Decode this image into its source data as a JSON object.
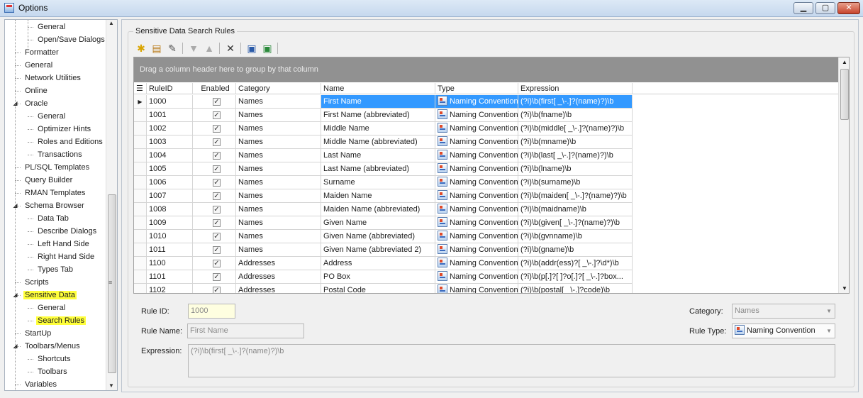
{
  "window": {
    "title": "Options",
    "min_label": "▁",
    "max_label": "▢",
    "close_label": "✕"
  },
  "tree": {
    "items": [
      {
        "label": "General",
        "level": 2,
        "highlight": false
      },
      {
        "label": "Open/Save Dialogs",
        "level": 2,
        "highlight": false
      },
      {
        "label": "Formatter",
        "level": 1,
        "highlight": false
      },
      {
        "label": "General",
        "level": 1,
        "highlight": false
      },
      {
        "label": "Network Utilities",
        "level": 1,
        "highlight": false
      },
      {
        "label": "Online",
        "level": 1,
        "highlight": false
      },
      {
        "label": "Oracle",
        "level": 1,
        "highlight": false,
        "expanded": true
      },
      {
        "label": "General",
        "level": 2,
        "highlight": false
      },
      {
        "label": "Optimizer Hints",
        "level": 2,
        "highlight": false
      },
      {
        "label": "Roles and Editions",
        "level": 2,
        "highlight": false
      },
      {
        "label": "Transactions",
        "level": 2,
        "highlight": false
      },
      {
        "label": "PL/SQL Templates",
        "level": 1,
        "highlight": false
      },
      {
        "label": "Query Builder",
        "level": 1,
        "highlight": false
      },
      {
        "label": "RMAN Templates",
        "level": 1,
        "highlight": false
      },
      {
        "label": "Schema Browser",
        "level": 1,
        "highlight": false,
        "expanded": true
      },
      {
        "label": "Data Tab",
        "level": 2,
        "highlight": false
      },
      {
        "label": "Describe Dialogs",
        "level": 2,
        "highlight": false
      },
      {
        "label": "Left Hand Side",
        "level": 2,
        "highlight": false
      },
      {
        "label": "Right Hand Side",
        "level": 2,
        "highlight": false
      },
      {
        "label": "Types Tab",
        "level": 2,
        "highlight": false
      },
      {
        "label": "Scripts",
        "level": 1,
        "highlight": false
      },
      {
        "label": "Sensitive Data",
        "level": 1,
        "highlight": true,
        "expanded": true
      },
      {
        "label": "General",
        "level": 2,
        "highlight": false
      },
      {
        "label": "Search Rules",
        "level": 2,
        "highlight": true
      },
      {
        "label": "StartUp",
        "level": 1,
        "highlight": false
      },
      {
        "label": "Toolbars/Menus",
        "level": 1,
        "highlight": false,
        "expanded": true
      },
      {
        "label": "Shortcuts",
        "level": 2,
        "highlight": false
      },
      {
        "label": "Toolbars",
        "level": 2,
        "highlight": false
      },
      {
        "label": "Variables",
        "level": 1,
        "highlight": false
      }
    ]
  },
  "panel": {
    "group_title": "Sensitive Data Search Rules",
    "group_by_hint": "Drag a column header here to group by that column",
    "columns": [
      "RuleID",
      "Enabled",
      "Category",
      "Name",
      "Type",
      "Expression"
    ],
    "rows": [
      {
        "id": "1000",
        "enabled": true,
        "category": "Names",
        "name": "First Name",
        "type": "Naming Convention",
        "expression": "(?i)\\b(first[ _\\-.]?(name)?)\\b"
      },
      {
        "id": "1001",
        "enabled": true,
        "category": "Names",
        "name": "First Name (abbreviated)",
        "type": "Naming Convention",
        "expression": "(?i)\\b(fname)\\b"
      },
      {
        "id": "1002",
        "enabled": true,
        "category": "Names",
        "name": "Middle Name",
        "type": "Naming Convention",
        "expression": "(?i)\\b(middle[ _\\-.]?(name)?)\\b"
      },
      {
        "id": "1003",
        "enabled": true,
        "category": "Names",
        "name": "Middle Name (abbreviated)",
        "type": "Naming Convention",
        "expression": "(?i)\\b(mname)\\b"
      },
      {
        "id": "1004",
        "enabled": true,
        "category": "Names",
        "name": "Last Name",
        "type": "Naming Convention",
        "expression": "(?i)\\b(last[ _\\-.]?(name)?)\\b"
      },
      {
        "id": "1005",
        "enabled": true,
        "category": "Names",
        "name": "Last Name (abbreviated)",
        "type": "Naming Convention",
        "expression": "(?i)\\b(lname)\\b"
      },
      {
        "id": "1006",
        "enabled": true,
        "category": "Names",
        "name": "Surname",
        "type": "Naming Convention",
        "expression": "(?i)\\b(surname)\\b"
      },
      {
        "id": "1007",
        "enabled": true,
        "category": "Names",
        "name": "Maiden Name",
        "type": "Naming Convention",
        "expression": "(?i)\\b(maiden[ _\\-.]?(name)?)\\b"
      },
      {
        "id": "1008",
        "enabled": true,
        "category": "Names",
        "name": "Maiden Name (abbreviated)",
        "type": "Naming Convention",
        "expression": "(?i)\\b(maidname)\\b"
      },
      {
        "id": "1009",
        "enabled": true,
        "category": "Names",
        "name": "Given Name",
        "type": "Naming Convention",
        "expression": "(?i)\\b(given[ _\\-.]?(name)?)\\b"
      },
      {
        "id": "1010",
        "enabled": true,
        "category": "Names",
        "name": "Given Name (abbreviated)",
        "type": "Naming Convention",
        "expression": "(?i)\\b(gvnname)\\b"
      },
      {
        "id": "1011",
        "enabled": true,
        "category": "Names",
        "name": "Given Name (abbreviated 2)",
        "type": "Naming Convention",
        "expression": "(?i)\\b(gname)\\b"
      },
      {
        "id": "1100",
        "enabled": true,
        "category": "Addresses",
        "name": "Address",
        "type": "Naming Convention",
        "expression": "(?i)\\b(addr(ess)?[ _\\-.]?\\d*)\\b"
      },
      {
        "id": "1101",
        "enabled": true,
        "category": "Addresses",
        "name": "PO Box",
        "type": "Naming Convention",
        "expression": "(?i)\\b(p[.]?[ ]?o[.]?[ _\\-.]?box..."
      },
      {
        "id": "1102",
        "enabled": true,
        "category": "Addresses",
        "name": "Postal Code",
        "type": "Naming Convention",
        "expression": "(?i)\\b(postal[ _\\-.]?code)\\b"
      }
    ],
    "selected_row": 0,
    "form": {
      "rule_id_label": "Rule ID:",
      "rule_id_value": "1000",
      "rule_name_label": "Rule Name:",
      "rule_name_value": "First Name",
      "expression_label": "Expression:",
      "expression_value": "(?i)\\b(first[ _\\-.]?(name)?)\\b",
      "category_label": "Category:",
      "category_value": "Names",
      "rule_type_label": "Rule Type:",
      "rule_type_value": "Naming Convention"
    }
  },
  "colors": {
    "selection": "#3399ff",
    "highlight": "#ffff3a",
    "group_area": "#919191"
  }
}
